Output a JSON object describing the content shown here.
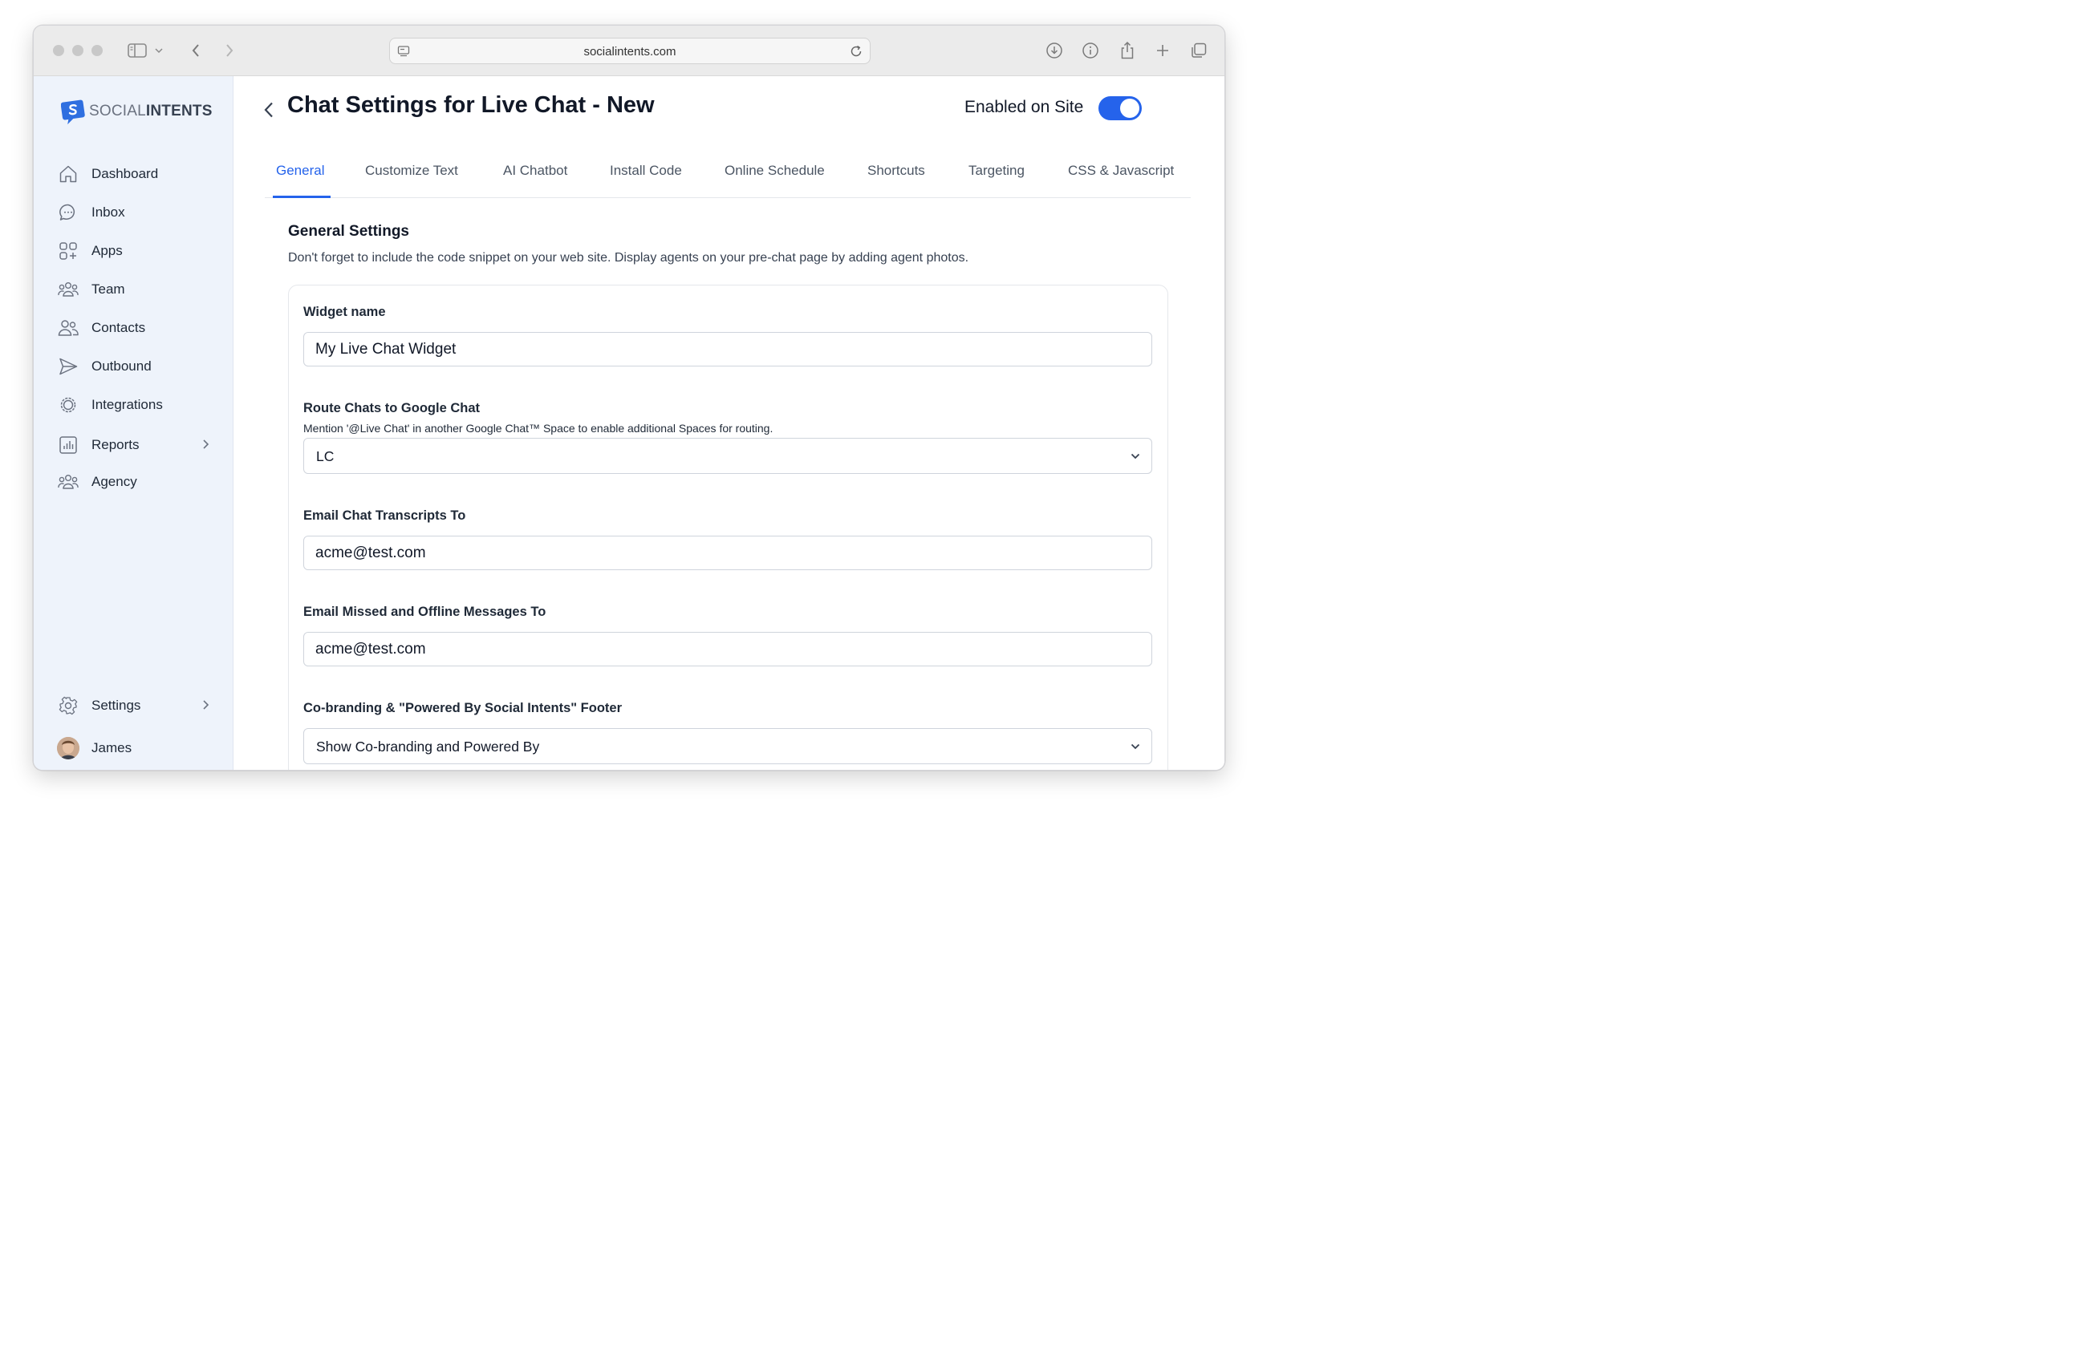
{
  "browser": {
    "url": "socialintents.com"
  },
  "sidebar": {
    "logo": {
      "light": "SOCIAL",
      "bold": "INTENTS"
    },
    "items": [
      {
        "label": "Dashboard",
        "icon": "home-icon"
      },
      {
        "label": "Inbox",
        "icon": "chat-bubble-icon"
      },
      {
        "label": "Apps",
        "icon": "apps-grid-icon"
      },
      {
        "label": "Team",
        "icon": "team-icon"
      },
      {
        "label": "Contacts",
        "icon": "contacts-icon"
      },
      {
        "label": "Outbound",
        "icon": "paper-plane-icon"
      },
      {
        "label": "Integrations",
        "icon": "integrations-gear-icon"
      },
      {
        "label": "Reports",
        "icon": "bar-chart-icon"
      },
      {
        "label": "Agency",
        "icon": "agency-icon"
      }
    ],
    "settings": {
      "label": "Settings",
      "icon": "gear-icon"
    },
    "user": {
      "name": "James"
    }
  },
  "header": {
    "title": "Chat Settings for Live Chat - New",
    "enabled_label": "Enabled on Site",
    "enabled": true
  },
  "tabs": [
    {
      "label": "General",
      "active": true
    },
    {
      "label": "Customize Text",
      "active": false
    },
    {
      "label": "AI Chatbot",
      "active": false
    },
    {
      "label": "Install Code",
      "active": false
    },
    {
      "label": "Online Schedule",
      "active": false
    },
    {
      "label": "Shortcuts",
      "active": false
    },
    {
      "label": "Targeting",
      "active": false
    },
    {
      "label": "CSS & Javascript",
      "active": false
    }
  ],
  "section": {
    "title": "General Settings",
    "description": "Don't forget to include the code snippet on your web site. Display agents on your pre-chat page by adding agent photos."
  },
  "form": {
    "widget_name": {
      "label": "Widget name",
      "value": "My Live Chat Widget"
    },
    "route_chats": {
      "label": "Route Chats to Google Chat",
      "help": "Mention '@Live Chat' in another Google Chat™ Space to enable additional Spaces for routing.",
      "value": "LC"
    },
    "email_transcripts": {
      "label": "Email Chat Transcripts To",
      "value": "acme@test.com"
    },
    "email_missed": {
      "label": "Email Missed and Offline Messages To",
      "value": "acme@test.com"
    },
    "cobranding": {
      "label": "Co-branding & \"Powered By Social Intents\" Footer",
      "value": "Show Co-branding and Powered By"
    }
  },
  "colors": {
    "accent": "#2563eb",
    "sidebar_bg": "#eef3fb",
    "logo_blue": "#2f6fe0"
  }
}
